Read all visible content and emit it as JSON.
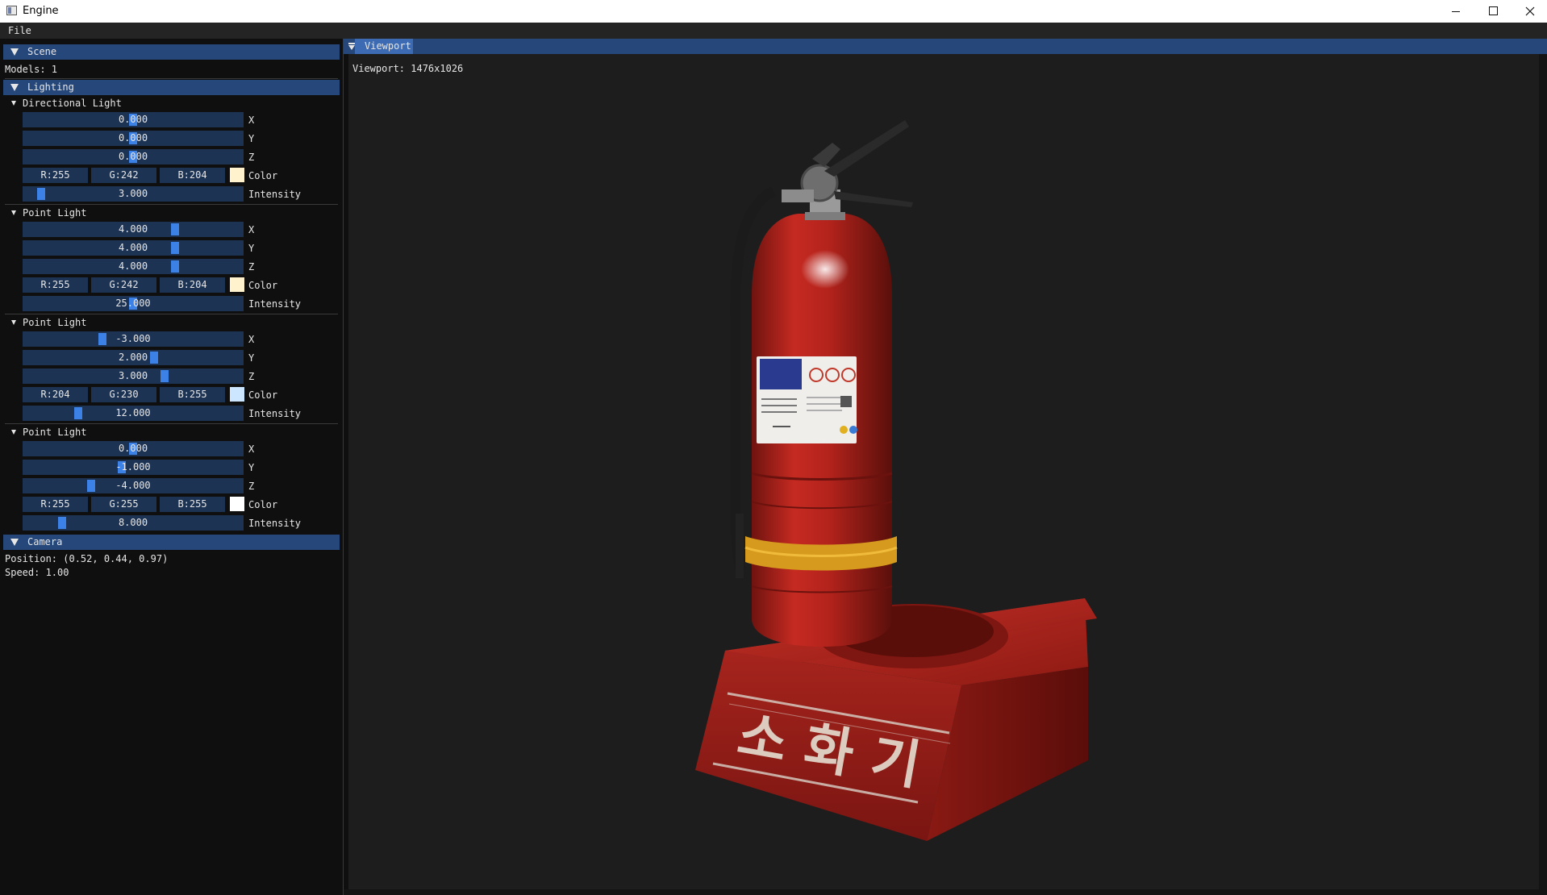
{
  "window": {
    "title": "Engine"
  },
  "menu": {
    "file": "File"
  },
  "scene": {
    "header": "Scene",
    "models": "Models: 1",
    "lighting_header": "Lighting",
    "lights": [
      {
        "title": "Directional Light",
        "x": "0.000",
        "y": "0.000",
        "z": "0.000",
        "r": "R:255",
        "g": "G:242",
        "b": "B:204",
        "color": "#fff2cc",
        "intensity": "3.000",
        "labels": {
          "x": "X",
          "y": "Y",
          "z": "Z",
          "color": "Color",
          "intensity": "Intensity"
        }
      },
      {
        "title": "Point Light",
        "x": "4.000",
        "y": "4.000",
        "z": "4.000",
        "r": "R:255",
        "g": "G:242",
        "b": "B:204",
        "color": "#fff2cc",
        "intensity": "25.000",
        "labels": {
          "x": "X",
          "y": "Y",
          "z": "Z",
          "color": "Color",
          "intensity": "Intensity"
        }
      },
      {
        "title": "Point Light",
        "x": "-3.000",
        "y": "2.000",
        "z": "3.000",
        "r": "R:204",
        "g": "G:230",
        "b": "B:255",
        "color": "#cce6ff",
        "intensity": "12.000",
        "labels": {
          "x": "X",
          "y": "Y",
          "z": "Z",
          "color": "Color",
          "intensity": "Intensity"
        }
      },
      {
        "title": "Point Light",
        "x": "0.000",
        "y": "-1.000",
        "z": "-4.000",
        "r": "R:255",
        "g": "G:255",
        "b": "B:255",
        "color": "#ffffff",
        "intensity": "8.000",
        "labels": {
          "x": "X",
          "y": "Y",
          "z": "Z",
          "color": "Color",
          "intensity": "Intensity"
        }
      }
    ],
    "camera_header": "Camera",
    "camera_position": "Position: (0.52, 0.44, 0.97)",
    "camera_speed": "Speed: 1.00"
  },
  "viewport": {
    "tab": "Viewport",
    "info": "Viewport: 1476x1026",
    "base_text": "소 화 기"
  },
  "colors": {
    "header": "#26477a",
    "slider_bg": "#1c3354",
    "grab": "#3c82e6",
    "extinguisher": "#b3231c"
  }
}
